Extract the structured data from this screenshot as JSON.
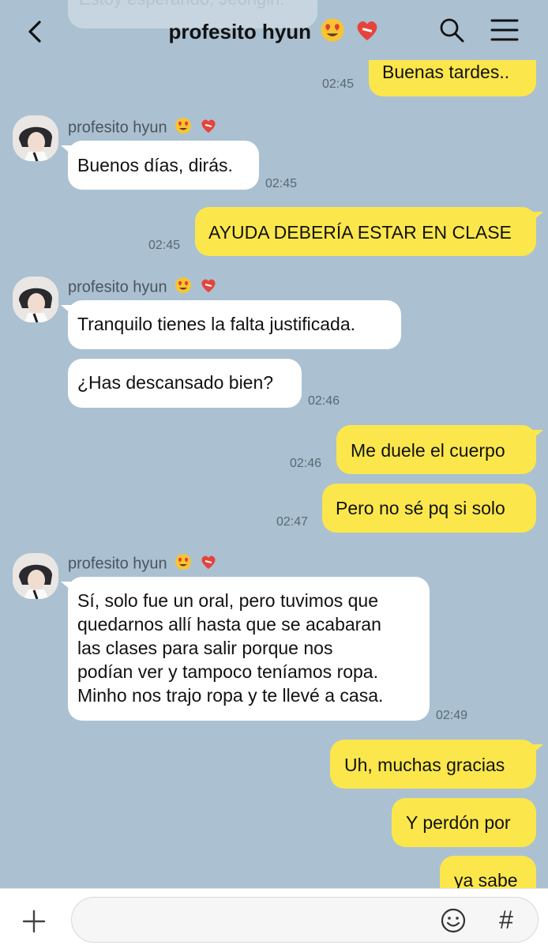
{
  "header": {
    "title": "profesito hyun",
    "prev_message": "Estoy esperando, Jeongin."
  },
  "contact": {
    "name": "profesito hyun"
  },
  "messages": [
    {
      "dir": "out",
      "text": "Buenas tardes..",
      "time": "02:45"
    },
    {
      "dir": "in",
      "text": "Buenos días, dirás.",
      "time": "02:45"
    },
    {
      "dir": "out",
      "text": "AYUDA DEBERÍA ESTAR EN CLASE",
      "time": "02:45"
    },
    {
      "dir": "in",
      "text": "Tranquilo tienes la falta justificada.",
      "time": ""
    },
    {
      "dir": "in",
      "text": "¿Has descansado bien?",
      "time": "02:46"
    },
    {
      "dir": "out",
      "text": "Me duele el cuerpo",
      "time": "02:46"
    },
    {
      "dir": "out",
      "text": "Pero no sé pq si solo",
      "time": "02:47"
    },
    {
      "dir": "in",
      "lines": [
        "Sí, solo fue un oral, pero tuvimos que",
        "quedarnos allí hasta que se acabaran",
        "las clases para salir porque nos",
        "podían ver y tampoco teníamos ropa.",
        "Minho nos trajo ropa y te llevé a casa."
      ],
      "time": "02:49"
    },
    {
      "dir": "out",
      "text": "Uh, muchas gracias",
      "time": ""
    },
    {
      "dir": "out",
      "text": "Y perdón por",
      "time": ""
    },
    {
      "dir": "out",
      "text": "ya sabe",
      "time": ""
    }
  ],
  "composer": {
    "placeholder": ""
  },
  "icons": {
    "back": "back-arrow-icon",
    "search": "search-icon",
    "menu": "menu-icon",
    "plus": "plus-icon",
    "emoji": "emoji-icon",
    "hash": "hashtag-icon",
    "title_emojis": [
      "heart-eyes-emoji",
      "mending-heart-emoji"
    ]
  },
  "colors": {
    "background": "#abc1d1",
    "outgoing_bubble": "#fbe74b",
    "incoming_bubble": "#ffffff",
    "timestamp": "#5a6772"
  }
}
